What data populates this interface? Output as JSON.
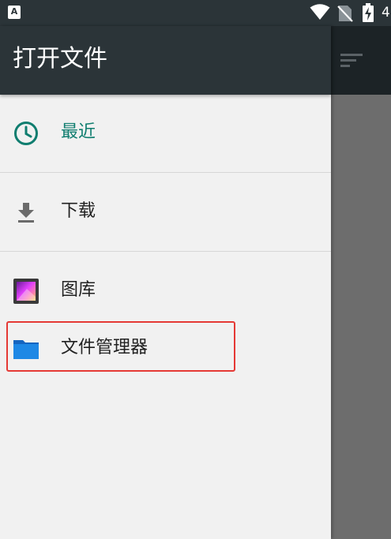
{
  "status_bar": {
    "left_icon_letter": "A",
    "time_fragment": "4"
  },
  "drawer": {
    "title": "打开文件",
    "sections": [
      {
        "items": [
          {
            "label": "最近",
            "icon": "clock-icon",
            "selected": true
          }
        ]
      },
      {
        "items": [
          {
            "label": "下载",
            "icon": "download-icon",
            "selected": false
          }
        ]
      },
      {
        "items": [
          {
            "label": "图库",
            "icon": "gallery-icon",
            "selected": false
          },
          {
            "label": "文件管理器",
            "icon": "folder-icon",
            "selected": false
          }
        ]
      }
    ]
  },
  "colors": {
    "header_bg": "#2b3438",
    "drawer_bg": "#f1f1f1",
    "accent": "#0f7d6f",
    "scrim": "#6d6d6d",
    "folder_blue": "#1e88e5",
    "highlight_border": "#e53935"
  }
}
